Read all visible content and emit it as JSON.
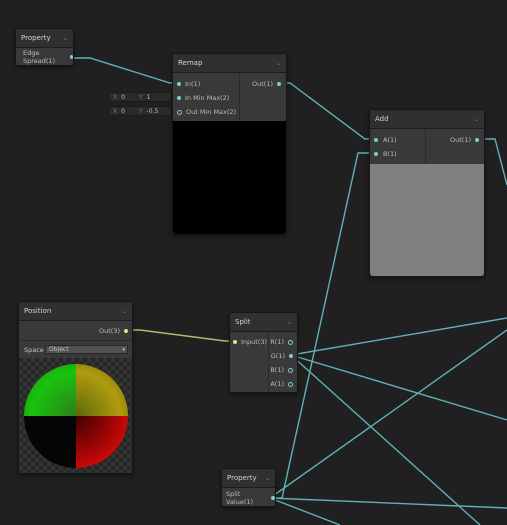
{
  "nodes": {
    "property_top": {
      "title": "Property",
      "port": "Edge Spread(1)"
    },
    "remap": {
      "title": "Remap",
      "inputs": [
        "In(1)",
        "In Min Max(2)",
        "Out Min Max(2)"
      ],
      "output": "Out(1)",
      "in_min_max": {
        "x_label": "X",
        "x_val": "0",
        "y_label": "Y",
        "y_val": "1"
      },
      "out_min_max": {
        "x_label": "X",
        "x_val": "0",
        "y_label": "Y",
        "y_val": "-0.5"
      }
    },
    "add": {
      "title": "Add",
      "inputs": [
        "A(1)",
        "B(1)"
      ],
      "output": "Out(1)"
    },
    "position": {
      "title": "Position",
      "output": "Out(3)",
      "space_label": "Space",
      "space_value": "Object"
    },
    "split": {
      "title": "Split",
      "input": "Input(3)",
      "outputs": [
        "R(1)",
        "G(1)",
        "B(1)",
        "A(1)"
      ]
    },
    "property_bottom": {
      "title": "Property",
      "port": "Split Value(1)"
    }
  },
  "colors": {
    "wire_float": "#5fb0b7",
    "wire_vector3": "#b8b76a",
    "background": "#202020"
  },
  "icons": [
    "chevron-down-icon",
    "dropdown-arrow-icon"
  ]
}
